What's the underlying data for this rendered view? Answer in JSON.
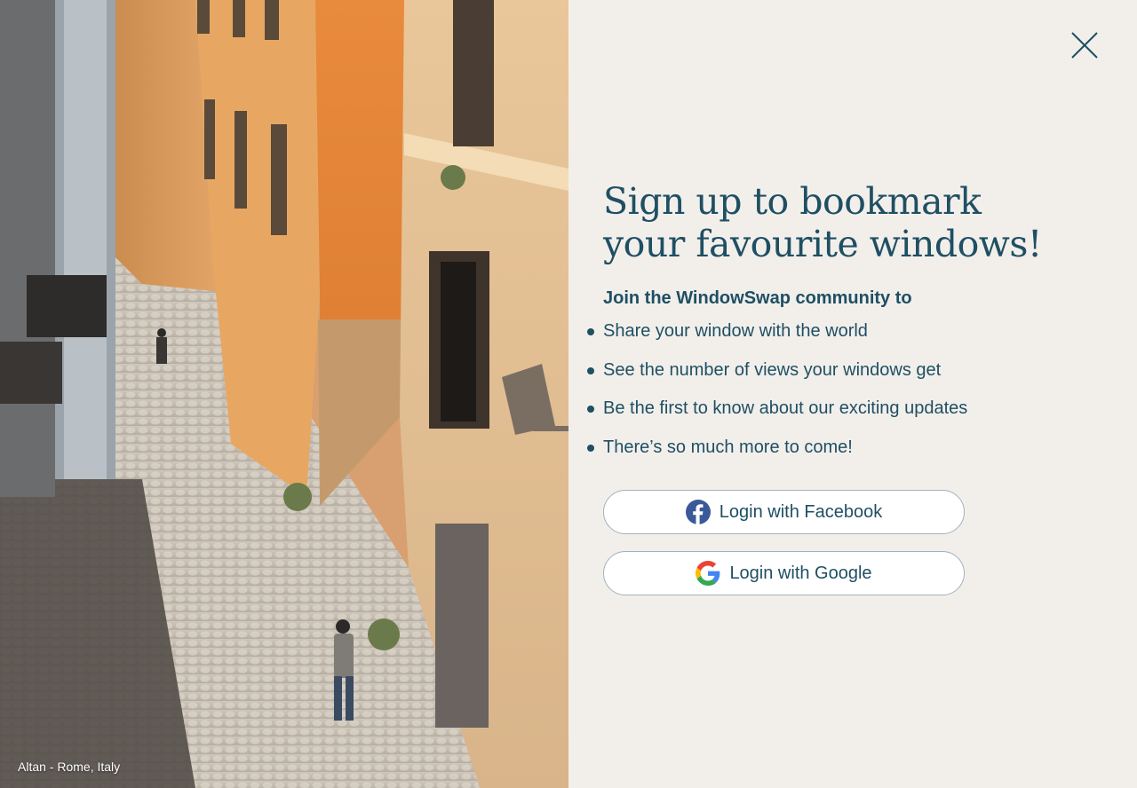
{
  "photo": {
    "caption": "Altan - Rome, Italy"
  },
  "panel": {
    "close_icon": "close-icon",
    "heading": "Sign up to bookmark your favourite windows!",
    "subheading": "Join the WindowSwap community to",
    "features": [
      "Share your window with the world",
      "See the number of views your windows get",
      "Be the first to know about our exciting updates",
      "There’s so much more to come!"
    ],
    "buttons": {
      "facebook_label": "Login with Facebook",
      "google_label": "Login with Google"
    }
  },
  "colors": {
    "background": "#f2efeb",
    "text": "#1f4f63",
    "facebook": "#3b5998"
  }
}
